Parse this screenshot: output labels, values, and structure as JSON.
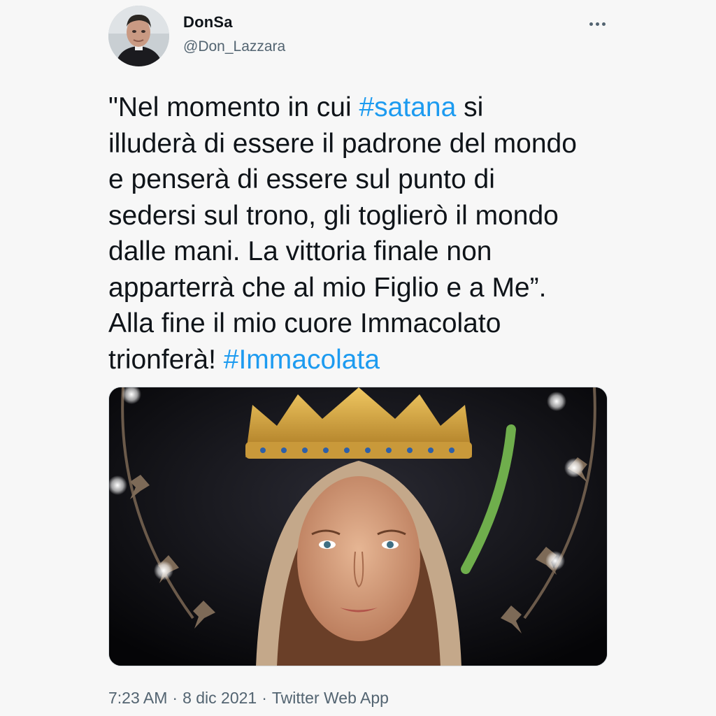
{
  "author": {
    "display_name": "DonSa",
    "handle": "@Don_Lazzara"
  },
  "tweet": {
    "lines": [
      [
        {
          "text": "\"Nel momento in cui ",
          "hashtag": false
        },
        {
          "text": "#satana",
          "hashtag": true
        },
        {
          "text": " si",
          "hashtag": false
        }
      ],
      [
        {
          "text": "illuderà di essere il padrone del mondo",
          "hashtag": false
        }
      ],
      [
        {
          "text": "e penserà di essere sul punto di",
          "hashtag": false
        }
      ],
      [
        {
          "text": "sedersi sul trono, gli toglierò il mondo",
          "hashtag": false
        }
      ],
      [
        {
          "text": "dalle mani. La vittoria finale non",
          "hashtag": false
        }
      ],
      [
        {
          "text": "apparterrà che al mio Figlio e a Me”.",
          "hashtag": false
        }
      ],
      [
        {
          "text": "Alla fine il mio cuore Immacolato",
          "hashtag": false
        }
      ],
      [
        {
          "text": "trionferà! ",
          "hashtag": false
        },
        {
          "text": "#Immacolata",
          "hashtag": true
        }
      ]
    ],
    "hashtag_color": "#1d9bf0"
  },
  "meta": {
    "time": "7:23 AM",
    "separator": "·",
    "date": "8 dic 2021",
    "source": "Twitter Web App"
  },
  "icons": {
    "more": "more-options-icon"
  }
}
